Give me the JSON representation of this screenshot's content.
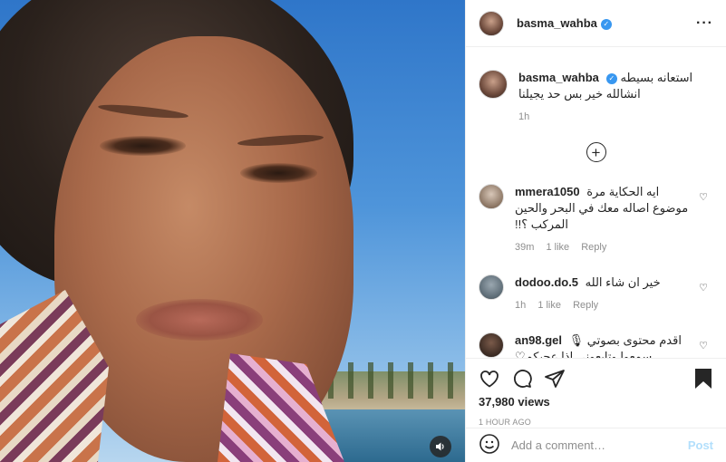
{
  "post_author": {
    "username": "basma_wahba",
    "verified_mark": "✓"
  },
  "header": {
    "more_icon": "more-horizontal-icon",
    "more_label": "···"
  },
  "caption": {
    "username": "basma_wahba",
    "text": "استعانه بسيطه انشالله خير بس حد يجيلنا",
    "time": "1h"
  },
  "load_more": {
    "icon": "plus-circle-icon",
    "label": "+"
  },
  "comments": [
    {
      "username": "mmera1050",
      "text": "ايه الحكاية مرة موضوع اصاله معك في البحر والحين المركب ؟!!",
      "time": "39m",
      "likes": "1 like",
      "reply": "Reply"
    },
    {
      "username": "dodoo.do.5",
      "text": "خير ان شاء الله",
      "time": "1h",
      "likes": "1 like",
      "reply": "Reply"
    },
    {
      "username": "an98.gel",
      "text": "اقدم محتوى بصوتي 🎙 سمعوا وتابعوني اذا عجبكم♡",
      "time": "",
      "likes": "",
      "reply": ""
    }
  ],
  "actions": {
    "views": "37,980 views",
    "timestamp": "1 HOUR AGO"
  },
  "add_comment": {
    "placeholder": "Add a comment…",
    "post_label": "Post"
  },
  "colors": {
    "link_blue": "#3897f0",
    "post_disabled": "#b2dffc",
    "muted": "#8e8e8e"
  }
}
